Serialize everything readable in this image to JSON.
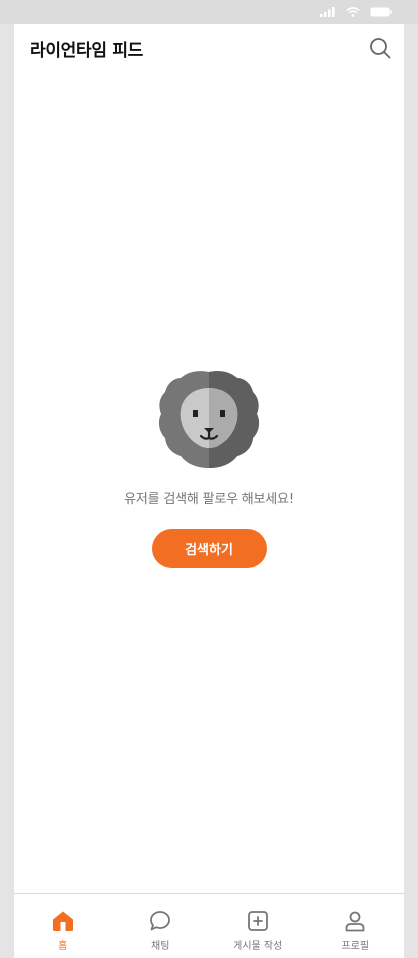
{
  "header": {
    "title": "라이언타임 피드"
  },
  "empty_state": {
    "message": "유저를 검색해 팔로우 해보세요!",
    "button_label": "검색하기"
  },
  "tabbar": {
    "items": [
      {
        "label": "홈",
        "icon": "home-icon",
        "active": true
      },
      {
        "label": "채팅",
        "icon": "chat-bubble-icon",
        "active": false
      },
      {
        "label": "게시물 작성",
        "icon": "plus-square-icon",
        "active": false
      },
      {
        "label": "프로필",
        "icon": "user-icon",
        "active": false
      }
    ]
  },
  "colors": {
    "accent": "#f26e22",
    "muted_text": "#767676"
  }
}
